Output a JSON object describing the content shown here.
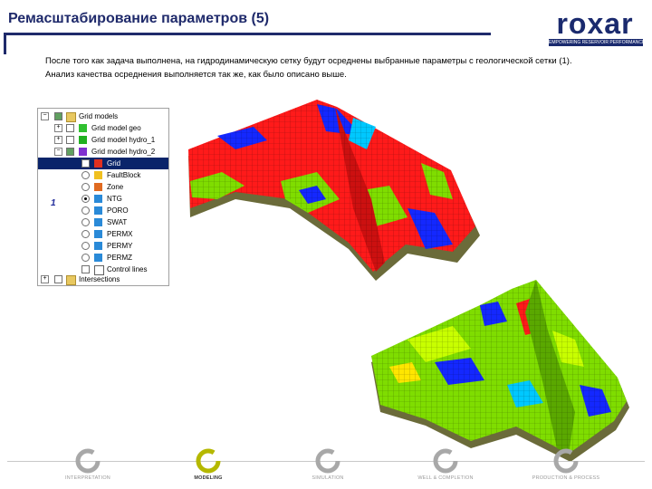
{
  "header": {
    "title": "Ремасштабирование параметров (5)",
    "logo_text": "roxar",
    "logo_tagline": "EMPOWERING RESERVOIR PERFORMANCE"
  },
  "body": {
    "paragraph1": "После того как задача выполнена, на гидродинамическую сетку будут осреднены выбранные параметры с геологической сетки (1).",
    "paragraph2": "Анализ качества осреднения выполняется так же, как было описано выше."
  },
  "tree": {
    "items": [
      {
        "label": "Grid models",
        "icon": "folder-icon"
      },
      {
        "label": "Grid model geo",
        "icon": "grid-model-icon"
      },
      {
        "label": "Grid model hydro_1",
        "icon": "grid-model-icon"
      },
      {
        "label": "Grid model hydro_2",
        "icon": "grid-model-icon"
      },
      {
        "label": "Grid",
        "icon": "grid-icon"
      },
      {
        "label": "FaultBlock",
        "icon": "parameter-icon"
      },
      {
        "label": "Zone",
        "icon": "parameter-icon"
      },
      {
        "label": "NTG",
        "icon": "parameter-icon"
      },
      {
        "label": "PORO",
        "icon": "parameter-icon"
      },
      {
        "label": "SWAT",
        "icon": "parameter-icon"
      },
      {
        "label": "PERMX",
        "icon": "parameter-icon"
      },
      {
        "label": "PERMY",
        "icon": "parameter-icon"
      },
      {
        "label": "PERMZ",
        "icon": "parameter-icon"
      },
      {
        "label": "Control lines",
        "icon": "control-lines-icon"
      },
      {
        "label": "Intersections",
        "icon": "folder-icon"
      }
    ],
    "selected": "Grid"
  },
  "marker_label": "1",
  "workflow": [
    {
      "label": "INTERPRETATION",
      "active": false
    },
    {
      "label": "MODELING",
      "active": true
    },
    {
      "label": "SIMULATION",
      "active": false
    },
    {
      "label": "WELL & COMPLETION",
      "active": false
    },
    {
      "label": "PRODUCTION & PROCESS",
      "active": false
    }
  ],
  "colors": {
    "title": "#1f2a6b",
    "selection": "#0a246a",
    "workflow_active": "#b5b800",
    "workflow_inactive": "#a8a8a8",
    "model_high": "#ff1a1a",
    "model_mid": "#7fdd00",
    "model_low": "#1428ff"
  }
}
